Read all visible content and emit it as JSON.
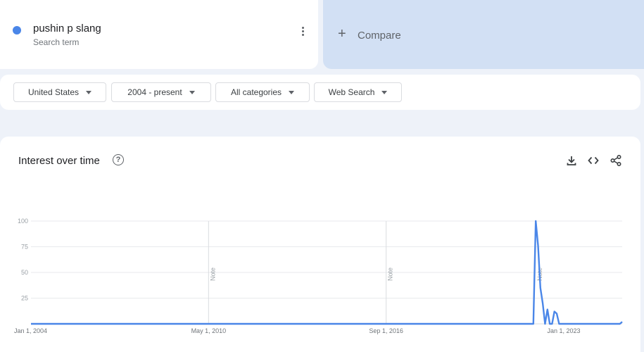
{
  "search_term": {
    "name": "pushin p slang",
    "subtitle": "Search term",
    "color": "#4a86e8"
  },
  "compare": {
    "label": "Compare"
  },
  "filters": {
    "region": "United States",
    "time_range": "2004 - present",
    "category": "All categories",
    "search_type": "Web Search"
  },
  "chart": {
    "title": "Interest over time",
    "note_label": "Note"
  },
  "chart_data": {
    "type": "line",
    "title": "Interest over time",
    "xlabel": "",
    "ylabel": "",
    "ylim": [
      0,
      100
    ],
    "yticks": [
      25,
      50,
      75,
      100
    ],
    "xtick_labels": [
      "Jan 1, 2004",
      "May 1, 2010",
      "Sep 1, 2016",
      "Jan 1, 2023"
    ],
    "grid": true,
    "notes_at": [
      "2010-05",
      "2016-09",
      "2022-01"
    ],
    "series": [
      {
        "name": "pushin p slang",
        "color": "#4a86e8",
        "points": [
          [
            "2004-01",
            0
          ],
          [
            "2021-10",
            0
          ],
          [
            "2021-11",
            0
          ],
          [
            "2021-12",
            0
          ],
          [
            "2022-01",
            100
          ],
          [
            "2022-02",
            76
          ],
          [
            "2022-03",
            35
          ],
          [
            "2022-04",
            20
          ],
          [
            "2022-05",
            0
          ],
          [
            "2022-06",
            14
          ],
          [
            "2022-07",
            0
          ],
          [
            "2022-08",
            0
          ],
          [
            "2022-09",
            12
          ],
          [
            "2022-10",
            10
          ],
          [
            "2022-11",
            0
          ],
          [
            "2022-12",
            0
          ],
          [
            "2023-06",
            0
          ],
          [
            "2024-06",
            0
          ],
          [
            "2025-01",
            0
          ],
          [
            "2025-02",
            2
          ]
        ]
      }
    ]
  }
}
